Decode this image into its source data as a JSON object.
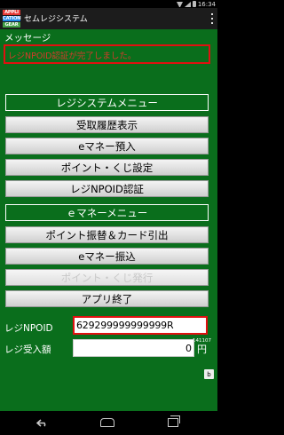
{
  "status_bar": {
    "time": "16:34"
  },
  "action_bar": {
    "logo_lines": [
      "APPLI",
      "CATION",
      "GEAR"
    ],
    "title": "セムレジシステム"
  },
  "message": {
    "label": "メッセージ",
    "text": "レジNPOID認証が完了しました。"
  },
  "menu": {
    "register_header": "レジシステムメニュー",
    "buttons": [
      {
        "label": "受取履歴表示"
      },
      {
        "label": "eマネー預入"
      },
      {
        "label": "ポイント・くじ設定"
      },
      {
        "label": "レジNPOID認証"
      }
    ],
    "emoney_header": "ｅマネーメニュー",
    "emoney_buttons": [
      {
        "label": "ポイント振替＆カード引出"
      },
      {
        "label": "eマネー振込"
      },
      {
        "label": "ポイント・くじ発行",
        "disabled": true
      },
      {
        "label": "アプリ終了"
      }
    ]
  },
  "version": "141107",
  "fields": {
    "reji_npoid_label": "レジNPOID",
    "reji_npoid_value": "629299999999999R",
    "amount_label": "レジ受入額",
    "amount_value": "0",
    "amount_unit": "円"
  },
  "b_button": "b",
  "colors": {
    "background": "#0a6e1c",
    "highlight_border": "#e01010",
    "message_text": "#d43a2a"
  }
}
